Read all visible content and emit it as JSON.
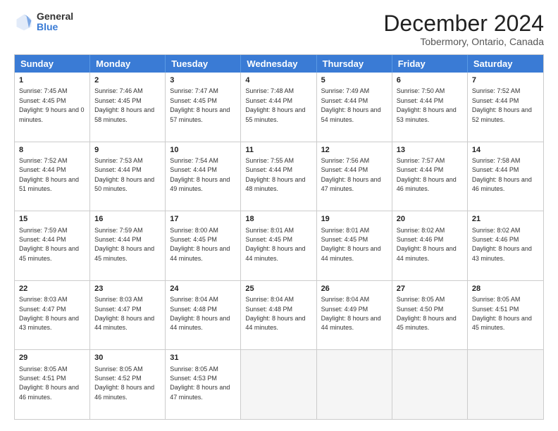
{
  "header": {
    "logo_general": "General",
    "logo_blue": "Blue",
    "main_title": "December 2024",
    "subtitle": "Tobermory, Ontario, Canada"
  },
  "days_of_week": [
    "Sunday",
    "Monday",
    "Tuesday",
    "Wednesday",
    "Thursday",
    "Friday",
    "Saturday"
  ],
  "weeks": [
    [
      {
        "day": "1",
        "rise": "Sunrise: 7:45 AM",
        "set": "Sunset: 4:45 PM",
        "daylight": "Daylight: 9 hours and 0 minutes."
      },
      {
        "day": "2",
        "rise": "Sunrise: 7:46 AM",
        "set": "Sunset: 4:45 PM",
        "daylight": "Daylight: 8 hours and 58 minutes."
      },
      {
        "day": "3",
        "rise": "Sunrise: 7:47 AM",
        "set": "Sunset: 4:45 PM",
        "daylight": "Daylight: 8 hours and 57 minutes."
      },
      {
        "day": "4",
        "rise": "Sunrise: 7:48 AM",
        "set": "Sunset: 4:44 PM",
        "daylight": "Daylight: 8 hours and 55 minutes."
      },
      {
        "day": "5",
        "rise": "Sunrise: 7:49 AM",
        "set": "Sunset: 4:44 PM",
        "daylight": "Daylight: 8 hours and 54 minutes."
      },
      {
        "day": "6",
        "rise": "Sunrise: 7:50 AM",
        "set": "Sunset: 4:44 PM",
        "daylight": "Daylight: 8 hours and 53 minutes."
      },
      {
        "day": "7",
        "rise": "Sunrise: 7:52 AM",
        "set": "Sunset: 4:44 PM",
        "daylight": "Daylight: 8 hours and 52 minutes."
      }
    ],
    [
      {
        "day": "8",
        "rise": "Sunrise: 7:52 AM",
        "set": "Sunset: 4:44 PM",
        "daylight": "Daylight: 8 hours and 51 minutes."
      },
      {
        "day": "9",
        "rise": "Sunrise: 7:53 AM",
        "set": "Sunset: 4:44 PM",
        "daylight": "Daylight: 8 hours and 50 minutes."
      },
      {
        "day": "10",
        "rise": "Sunrise: 7:54 AM",
        "set": "Sunset: 4:44 PM",
        "daylight": "Daylight: 8 hours and 49 minutes."
      },
      {
        "day": "11",
        "rise": "Sunrise: 7:55 AM",
        "set": "Sunset: 4:44 PM",
        "daylight": "Daylight: 8 hours and 48 minutes."
      },
      {
        "day": "12",
        "rise": "Sunrise: 7:56 AM",
        "set": "Sunset: 4:44 PM",
        "daylight": "Daylight: 8 hours and 47 minutes."
      },
      {
        "day": "13",
        "rise": "Sunrise: 7:57 AM",
        "set": "Sunset: 4:44 PM",
        "daylight": "Daylight: 8 hours and 46 minutes."
      },
      {
        "day": "14",
        "rise": "Sunrise: 7:58 AM",
        "set": "Sunset: 4:44 PM",
        "daylight": "Daylight: 8 hours and 46 minutes."
      }
    ],
    [
      {
        "day": "15",
        "rise": "Sunrise: 7:59 AM",
        "set": "Sunset: 4:44 PM",
        "daylight": "Daylight: 8 hours and 45 minutes."
      },
      {
        "day": "16",
        "rise": "Sunrise: 7:59 AM",
        "set": "Sunset: 4:44 PM",
        "daylight": "Daylight: 8 hours and 45 minutes."
      },
      {
        "day": "17",
        "rise": "Sunrise: 8:00 AM",
        "set": "Sunset: 4:45 PM",
        "daylight": "Daylight: 8 hours and 44 minutes."
      },
      {
        "day": "18",
        "rise": "Sunrise: 8:01 AM",
        "set": "Sunset: 4:45 PM",
        "daylight": "Daylight: 8 hours and 44 minutes."
      },
      {
        "day": "19",
        "rise": "Sunrise: 8:01 AM",
        "set": "Sunset: 4:45 PM",
        "daylight": "Daylight: 8 hours and 44 minutes."
      },
      {
        "day": "20",
        "rise": "Sunrise: 8:02 AM",
        "set": "Sunset: 4:46 PM",
        "daylight": "Daylight: 8 hours and 44 minutes."
      },
      {
        "day": "21",
        "rise": "Sunrise: 8:02 AM",
        "set": "Sunset: 4:46 PM",
        "daylight": "Daylight: 8 hours and 43 minutes."
      }
    ],
    [
      {
        "day": "22",
        "rise": "Sunrise: 8:03 AM",
        "set": "Sunset: 4:47 PM",
        "daylight": "Daylight: 8 hours and 43 minutes."
      },
      {
        "day": "23",
        "rise": "Sunrise: 8:03 AM",
        "set": "Sunset: 4:47 PM",
        "daylight": "Daylight: 8 hours and 44 minutes."
      },
      {
        "day": "24",
        "rise": "Sunrise: 8:04 AM",
        "set": "Sunset: 4:48 PM",
        "daylight": "Daylight: 8 hours and 44 minutes."
      },
      {
        "day": "25",
        "rise": "Sunrise: 8:04 AM",
        "set": "Sunset: 4:48 PM",
        "daylight": "Daylight: 8 hours and 44 minutes."
      },
      {
        "day": "26",
        "rise": "Sunrise: 8:04 AM",
        "set": "Sunset: 4:49 PM",
        "daylight": "Daylight: 8 hours and 44 minutes."
      },
      {
        "day": "27",
        "rise": "Sunrise: 8:05 AM",
        "set": "Sunset: 4:50 PM",
        "daylight": "Daylight: 8 hours and 45 minutes."
      },
      {
        "day": "28",
        "rise": "Sunrise: 8:05 AM",
        "set": "Sunset: 4:51 PM",
        "daylight": "Daylight: 8 hours and 45 minutes."
      }
    ],
    [
      {
        "day": "29",
        "rise": "Sunrise: 8:05 AM",
        "set": "Sunset: 4:51 PM",
        "daylight": "Daylight: 8 hours and 46 minutes."
      },
      {
        "day": "30",
        "rise": "Sunrise: 8:05 AM",
        "set": "Sunset: 4:52 PM",
        "daylight": "Daylight: 8 hours and 46 minutes."
      },
      {
        "day": "31",
        "rise": "Sunrise: 8:05 AM",
        "set": "Sunset: 4:53 PM",
        "daylight": "Daylight: 8 hours and 47 minutes."
      },
      null,
      null,
      null,
      null
    ]
  ]
}
